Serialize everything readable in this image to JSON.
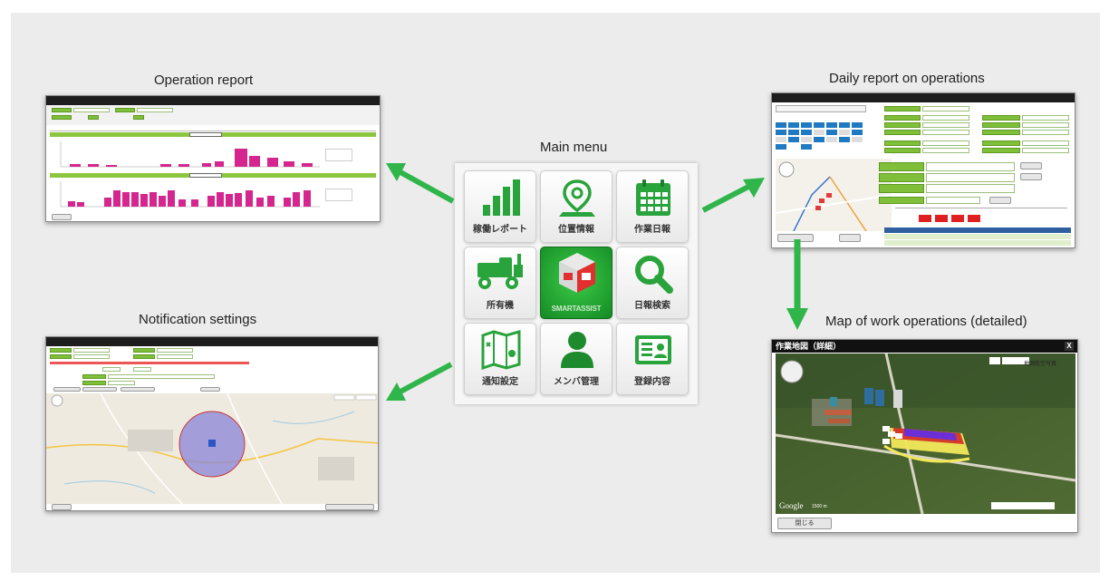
{
  "captions": {
    "operation_report": "Operation report",
    "main_menu": "Main menu",
    "daily_report": "Daily report on operations",
    "notification_settings": "Notification settings",
    "map_detailed": "Map of work operations (detailed)"
  },
  "menu": {
    "items": [
      {
        "label": "稼働レポート",
        "icon": "bar-chart-icon"
      },
      {
        "label": "位置情報",
        "icon": "map-pin-icon"
      },
      {
        "label": "作業日報",
        "icon": "calendar-icon"
      },
      {
        "label": "所有機",
        "icon": "tractor-icon"
      },
      {
        "label": "SMARTASSIST",
        "icon": "smartassist-logo-icon"
      },
      {
        "label": "日報検索",
        "icon": "magnifier-icon"
      },
      {
        "label": "通知設定",
        "icon": "folded-map-icon"
      },
      {
        "label": "メンバ管理",
        "icon": "person-icon"
      },
      {
        "label": "登録内容",
        "icon": "id-card-icon"
      }
    ]
  },
  "map_window": {
    "title": "作業地図（詳細）",
    "close": "X",
    "map_toggle": [
      "地図",
      "航空写真"
    ],
    "close_button": "閉じる",
    "google": "Google",
    "scale": "1500 m"
  },
  "colors": {
    "accent_green": "#29a33b",
    "arrow_green": "#2fb54a",
    "bar_magenta": "#d4268e",
    "alert_red": "#e02020"
  }
}
